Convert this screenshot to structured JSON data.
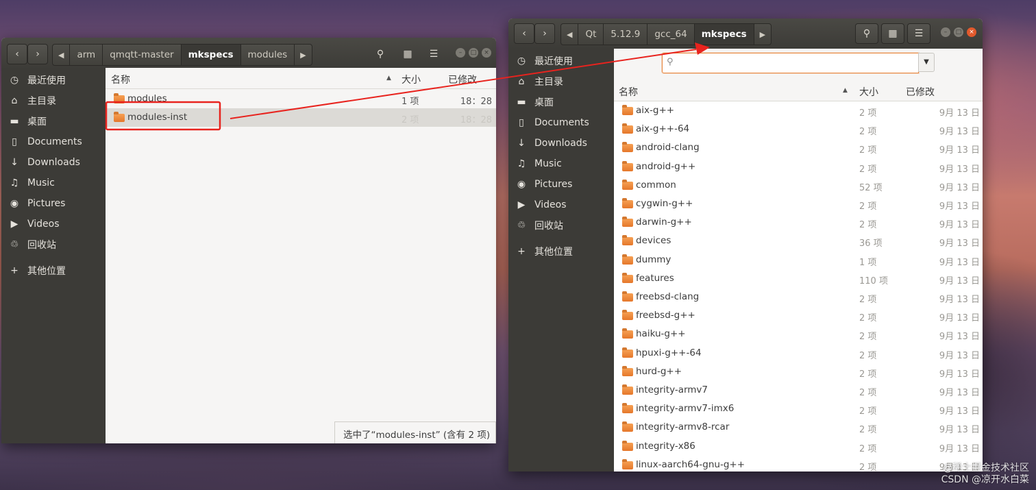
{
  "left_window": {
    "breadcrumbs": [
      "arm",
      "qmqtt-master",
      "mkspecs",
      "modules"
    ],
    "active_crumb": "mkspecs",
    "columns": {
      "name": "名称",
      "size": "大小",
      "modified": "已修改"
    },
    "rows": [
      {
        "name": "modules",
        "size": "1 项",
        "date": "18：28",
        "selected": false
      },
      {
        "name": "modules-inst",
        "size": "2 项",
        "date": "18：28",
        "selected": true
      }
    ],
    "status": "选中了“modules-inst” (含有 2 项)"
  },
  "right_window": {
    "breadcrumbs": [
      "Qt",
      "5.12.9",
      "gcc_64",
      "mkspecs"
    ],
    "active_crumb": "mkspecs",
    "search_value": "",
    "columns": {
      "name": "名称",
      "size": "大小",
      "modified": "已修改"
    },
    "rows": [
      {
        "name": "aix-g++",
        "size": "2 项",
        "date": "9月 13 日"
      },
      {
        "name": "aix-g++-64",
        "size": "2 项",
        "date": "9月 13 日"
      },
      {
        "name": "android-clang",
        "size": "2 项",
        "date": "9月 13 日"
      },
      {
        "name": "android-g++",
        "size": "2 项",
        "date": "9月 13 日"
      },
      {
        "name": "common",
        "size": "52 项",
        "date": "9月 13 日"
      },
      {
        "name": "cygwin-g++",
        "size": "2 项",
        "date": "9月 13 日"
      },
      {
        "name": "darwin-g++",
        "size": "2 项",
        "date": "9月 13 日"
      },
      {
        "name": "devices",
        "size": "36 项",
        "date": "9月 13 日"
      },
      {
        "name": "dummy",
        "size": "1 项",
        "date": "9月 13 日"
      },
      {
        "name": "features",
        "size": "110 项",
        "date": "9月 13 日"
      },
      {
        "name": "freebsd-clang",
        "size": "2 项",
        "date": "9月 13 日"
      },
      {
        "name": "freebsd-g++",
        "size": "2 项",
        "date": "9月 13 日"
      },
      {
        "name": "haiku-g++",
        "size": "2 项",
        "date": "9月 13 日"
      },
      {
        "name": "hpuxi-g++-64",
        "size": "2 项",
        "date": "9月 13 日"
      },
      {
        "name": "hurd-g++",
        "size": "2 项",
        "date": "9月 13 日"
      },
      {
        "name": "integrity-armv7",
        "size": "2 项",
        "date": "9月 13 日"
      },
      {
        "name": "integrity-armv7-imx6",
        "size": "2 项",
        "date": "9月 13 日"
      },
      {
        "name": "integrity-armv8-rcar",
        "size": "2 项",
        "date": "9月 13 日"
      },
      {
        "name": "integrity-x86",
        "size": "2 项",
        "date": "9月 13 日"
      },
      {
        "name": "linux-aarch64-gnu-g++",
        "size": "2 项",
        "date": "9月 13 日"
      }
    ]
  },
  "sidebar": [
    {
      "label": "最近使用",
      "icon": "clock-icon"
    },
    {
      "label": "主目录",
      "icon": "home-icon"
    },
    {
      "label": "桌面",
      "icon": "folder-icon"
    },
    {
      "label": "Documents",
      "icon": "document-icon"
    },
    {
      "label": "Downloads",
      "icon": "download-icon"
    },
    {
      "label": "Music",
      "icon": "music-icon"
    },
    {
      "label": "Pictures",
      "icon": "camera-icon"
    },
    {
      "label": "Videos",
      "icon": "video-icon"
    },
    {
      "label": "回收站",
      "icon": "trash-icon"
    },
    {
      "label": "其他位置",
      "icon": "plus-icon"
    }
  ],
  "watermark": {
    "line1": "@稀土掘金技术社区",
    "line2": "CSDN @凉开水白菜"
  },
  "colors": {
    "headerbar": "#3c3b37",
    "sidebar": "#3c3b37",
    "accent": "#e95420",
    "annotation": "#e8231e"
  }
}
